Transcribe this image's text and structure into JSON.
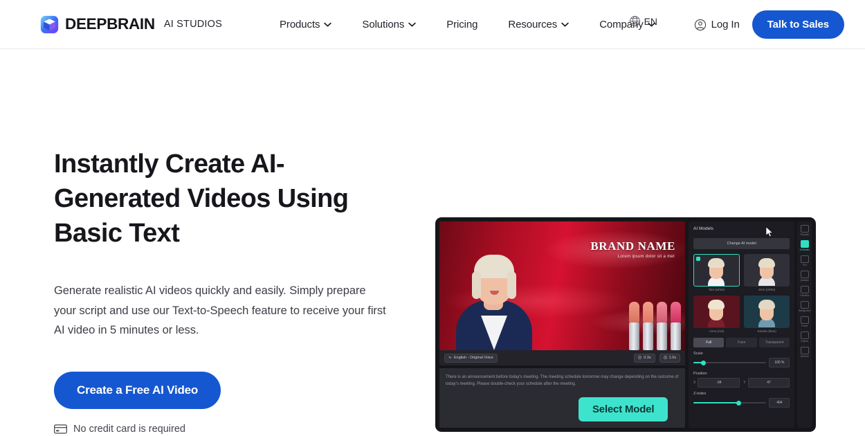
{
  "brand": {
    "name": "DEEPBRAIN",
    "suffix": "AI STUDIOS",
    "logo_icon": "cube-logo-icon",
    "accent_blue": "#1557d0",
    "accent_teal": "#3ee3ce"
  },
  "header": {
    "nav": [
      {
        "label": "Products",
        "has_dropdown": true
      },
      {
        "label": "Solutions",
        "has_dropdown": true
      },
      {
        "label": "Pricing",
        "has_dropdown": false
      },
      {
        "label": "Resources",
        "has_dropdown": true
      },
      {
        "label": "Company",
        "has_dropdown": true
      }
    ],
    "language": {
      "label": "EN",
      "icon": "globe-icon"
    },
    "login": {
      "label": "Log In",
      "icon": "user-circle-icon"
    },
    "cta": {
      "label": "Talk to Sales"
    }
  },
  "hero": {
    "title": "Instantly Create AI-Generated Videos Using Basic Text",
    "subtitle": "Generate realistic AI videos quickly and easily. Simply prepare your script and use our Text-to-Speech feature to receive your first AI video in 5 minutes or less.",
    "cta_label": "Create a Free AI Video",
    "note": "No credit card is required",
    "note_icon": "credit-card-icon"
  },
  "preview": {
    "stage": {
      "brand_name": "BRAND NAME",
      "brand_tagline": "Lorem ipsum dolor sit a met"
    },
    "toolbar": {
      "voice_label": "English - Original Voice",
      "voice_icon": "voice-wave-icon",
      "timings": [
        {
          "label": "0.3s",
          "icon": "clock-icon"
        },
        {
          "label": "1.0s",
          "icon": "clock-icon"
        }
      ]
    },
    "script_text": "There is an announcement before today's meeting. The meeting schedule tomorrow may change depending on the outcome of today's meeting. Please double-check your schedule after the meeting.",
    "panel": {
      "title": "AI Models",
      "change_button": "Change AI model",
      "models": [
        {
          "name": "Tara (white)",
          "selected": true,
          "bg": "#2b2b33",
          "body": "#f2f2f5"
        },
        {
          "name": "Jenn (white)",
          "selected": false,
          "bg": "#303038",
          "body": "#e6e6ea"
        },
        {
          "name": "Anna (red)",
          "selected": false,
          "bg": "#5a1420",
          "body": "#7a1f2c"
        },
        {
          "name": "Sandra (blue)",
          "selected": false,
          "bg": "#1d3a47",
          "body": "#6f9bb0"
        }
      ],
      "segments": [
        {
          "label": "Full",
          "active": true
        },
        {
          "label": "Face",
          "active": false
        },
        {
          "label": "Transparent",
          "active": false
        }
      ],
      "controls": [
        {
          "label": "Scale",
          "value": "100 %",
          "fill_pct": 12
        },
        {
          "label": "Z-index",
          "value": "404",
          "fill_pct": 62
        }
      ],
      "position": {
        "label": "Position",
        "x": {
          "axis": "X",
          "value": "-34"
        },
        "y": {
          "axis": "Y",
          "value": "47"
        }
      }
    },
    "rail": [
      {
        "label": "Template",
        "icon": "template-icon",
        "active": false
      },
      {
        "label": "AI Models",
        "icon": "person-icon",
        "active": true
      },
      {
        "label": "Text",
        "icon": "text-icon",
        "active": false
      },
      {
        "label": "Question",
        "icon": "question-icon",
        "active": false
      },
      {
        "label": "Transition",
        "icon": "transition-icon",
        "active": false
      },
      {
        "label": "Background",
        "icon": "background-icon",
        "active": false
      },
      {
        "label": "Frame",
        "icon": "frame-icon",
        "active": false
      },
      {
        "label": "Graphic",
        "icon": "graphic-icon",
        "active": false
      },
      {
        "label": "Element",
        "icon": "element-icon",
        "active": false
      }
    ],
    "overlay_button": "Select Model",
    "cursor_icon": "mouse-pointer-icon"
  }
}
